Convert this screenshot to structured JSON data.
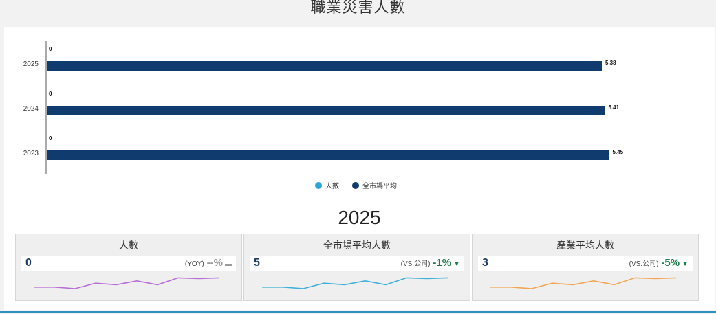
{
  "page": {
    "title": "職業災害人數"
  },
  "colors": {
    "series_1": "#2aa5d6",
    "series_2": "#0f3b6e",
    "change_green": "#1e7d4a",
    "change_gray": "#9a9a9a",
    "spark_purple": "#b66ed6",
    "spark_blue": "#3fb0d8",
    "spark_orange": "#f2a653"
  },
  "chart_data": {
    "type": "bar",
    "orientation": "horizontal",
    "categories": [
      "2025",
      "2024",
      "2023"
    ],
    "series": [
      {
        "name": "人數",
        "values": [
          0,
          0,
          0
        ],
        "color": "#2aa5d6"
      },
      {
        "name": "全市場平均",
        "values": [
          5.38,
          5.41,
          5.45
        ],
        "color": "#0f3b6e"
      }
    ],
    "data_labels": {
      "series_1": [
        "0",
        "0",
        "0"
      ],
      "series_2": [
        "5.38",
        "5.41",
        "5.45"
      ]
    },
    "xlim": [
      0,
      6.12
    ],
    "grid": false,
    "legend_position": "bottom"
  },
  "summary": {
    "year": "2025",
    "cards": [
      {
        "title": "人數",
        "value": "0",
        "compare_label": "(YOY)",
        "compare_value": "--%",
        "trend": "flat",
        "sparkline": [
          2,
          2,
          1.6,
          3,
          2.6,
          3.6,
          2.6,
          4.4,
          4.2,
          4.4
        ],
        "spark_icon": "sparkline-purple-icon"
      },
      {
        "title": "全市場平均人數",
        "value": "5",
        "compare_label": "(VS.公司)",
        "compare_value": "-1%",
        "trend": "down",
        "sparkline": [
          2,
          2,
          1.6,
          3,
          2.6,
          3.6,
          2.6,
          4.4,
          4.2,
          4.4
        ],
        "spark_icon": "sparkline-blue-icon"
      },
      {
        "title": "產業平均人數",
        "value": "3",
        "compare_label": "(VS.公司)",
        "compare_value": "-5%",
        "trend": "down",
        "sparkline": [
          2,
          2,
          1.6,
          3,
          2.6,
          3.6,
          2.6,
          4.4,
          4.2,
          4.4
        ],
        "spark_icon": "sparkline-orange-icon"
      }
    ]
  }
}
